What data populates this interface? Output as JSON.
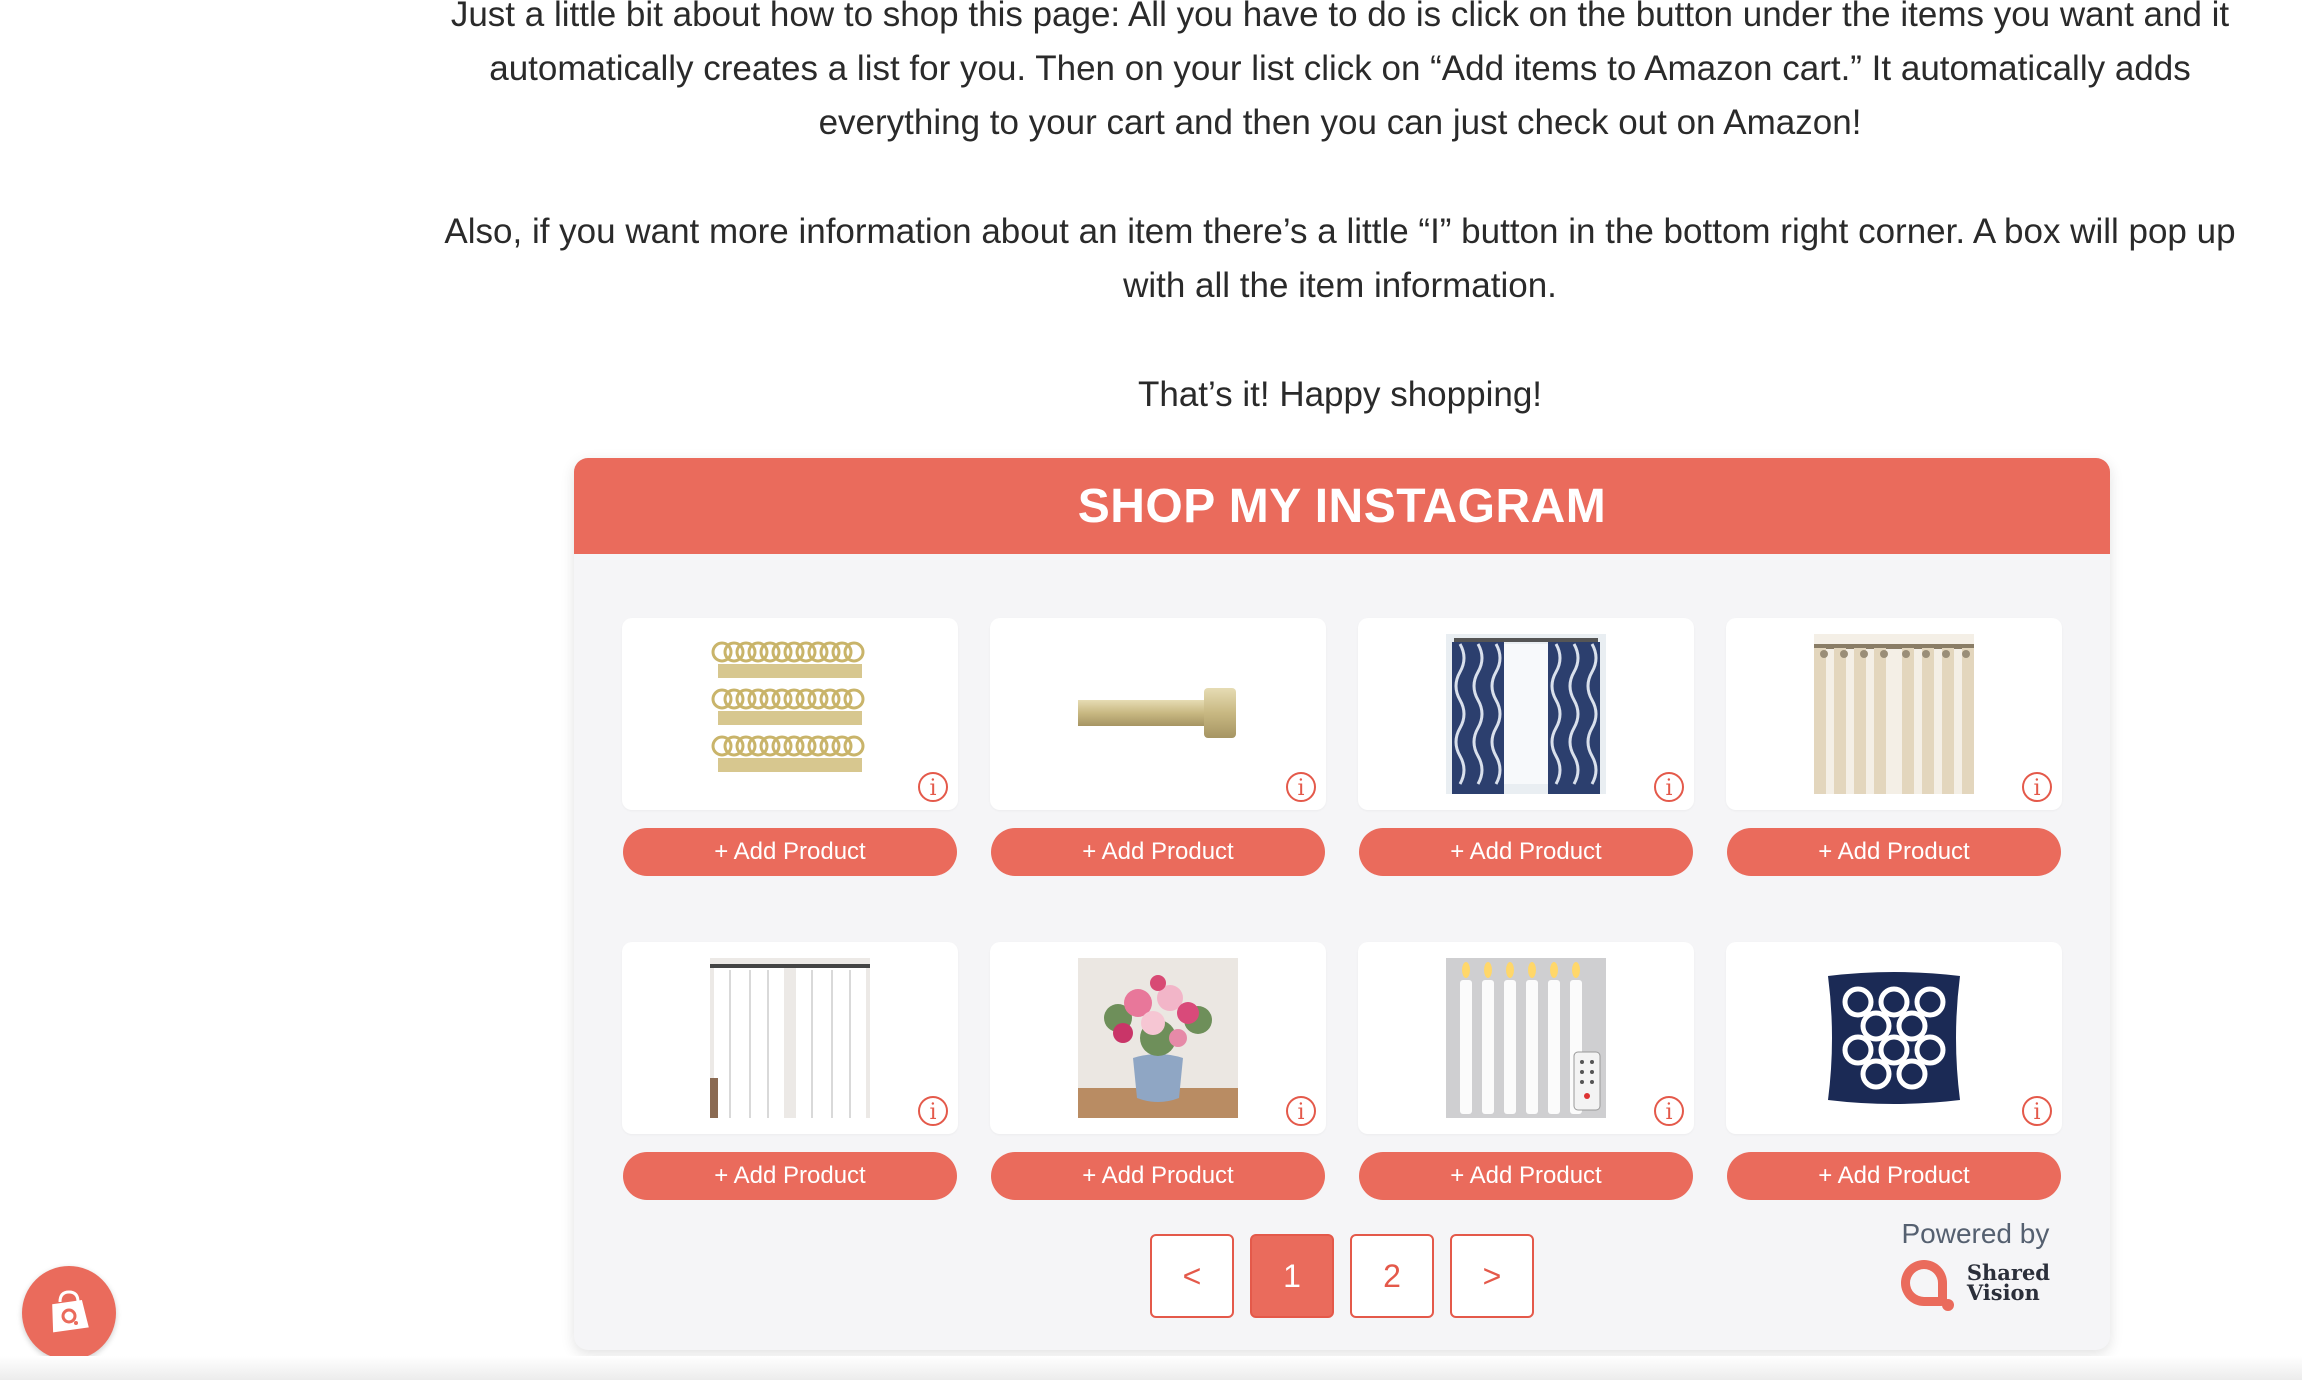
{
  "intro": {
    "para1": "Just a little bit about how to shop this page: All you have to do is click on the button under the items you want and it automatically creates a list for you. Then on your list click on “Add items to Amazon cart.” It automatically adds everything to your cart and then you can just check out on Amazon!",
    "para2": "Also, if you want more information about an item there’s a little “I” button in the bottom right corner. A box will pop up with all the item information.",
    "para3": "That’s it! Happy shopping!"
  },
  "widget": {
    "title": "SHOP MY INSTAGRAM",
    "accent": "#ea6b5c",
    "info_glyph": "i",
    "products": [
      {
        "image": "curtain-ring-clips",
        "button": "+ Add Product"
      },
      {
        "image": "curtain-rod",
        "button": "+ Add Product"
      },
      {
        "image": "navy-trellis-curtains",
        "button": "+ Add Product"
      },
      {
        "image": "beige-striped-curtains",
        "button": "+ Add Product"
      },
      {
        "image": "white-curtains",
        "button": "+ Add Product"
      },
      {
        "image": "pink-flower-vase",
        "button": "+ Add Product"
      },
      {
        "image": "flameless-taper-candles",
        "button": "+ Add Product"
      },
      {
        "image": "navy-trellis-pillow",
        "button": "+ Add Product"
      }
    ],
    "pagination": {
      "prev": "<",
      "pages": [
        "1",
        "2"
      ],
      "current": "1",
      "next": ">"
    },
    "powered_by": "Powered by",
    "brand_line1": "Shared",
    "brand_line2": "Vision"
  },
  "floating_button": {
    "icon": "shopping-bag-icon"
  }
}
